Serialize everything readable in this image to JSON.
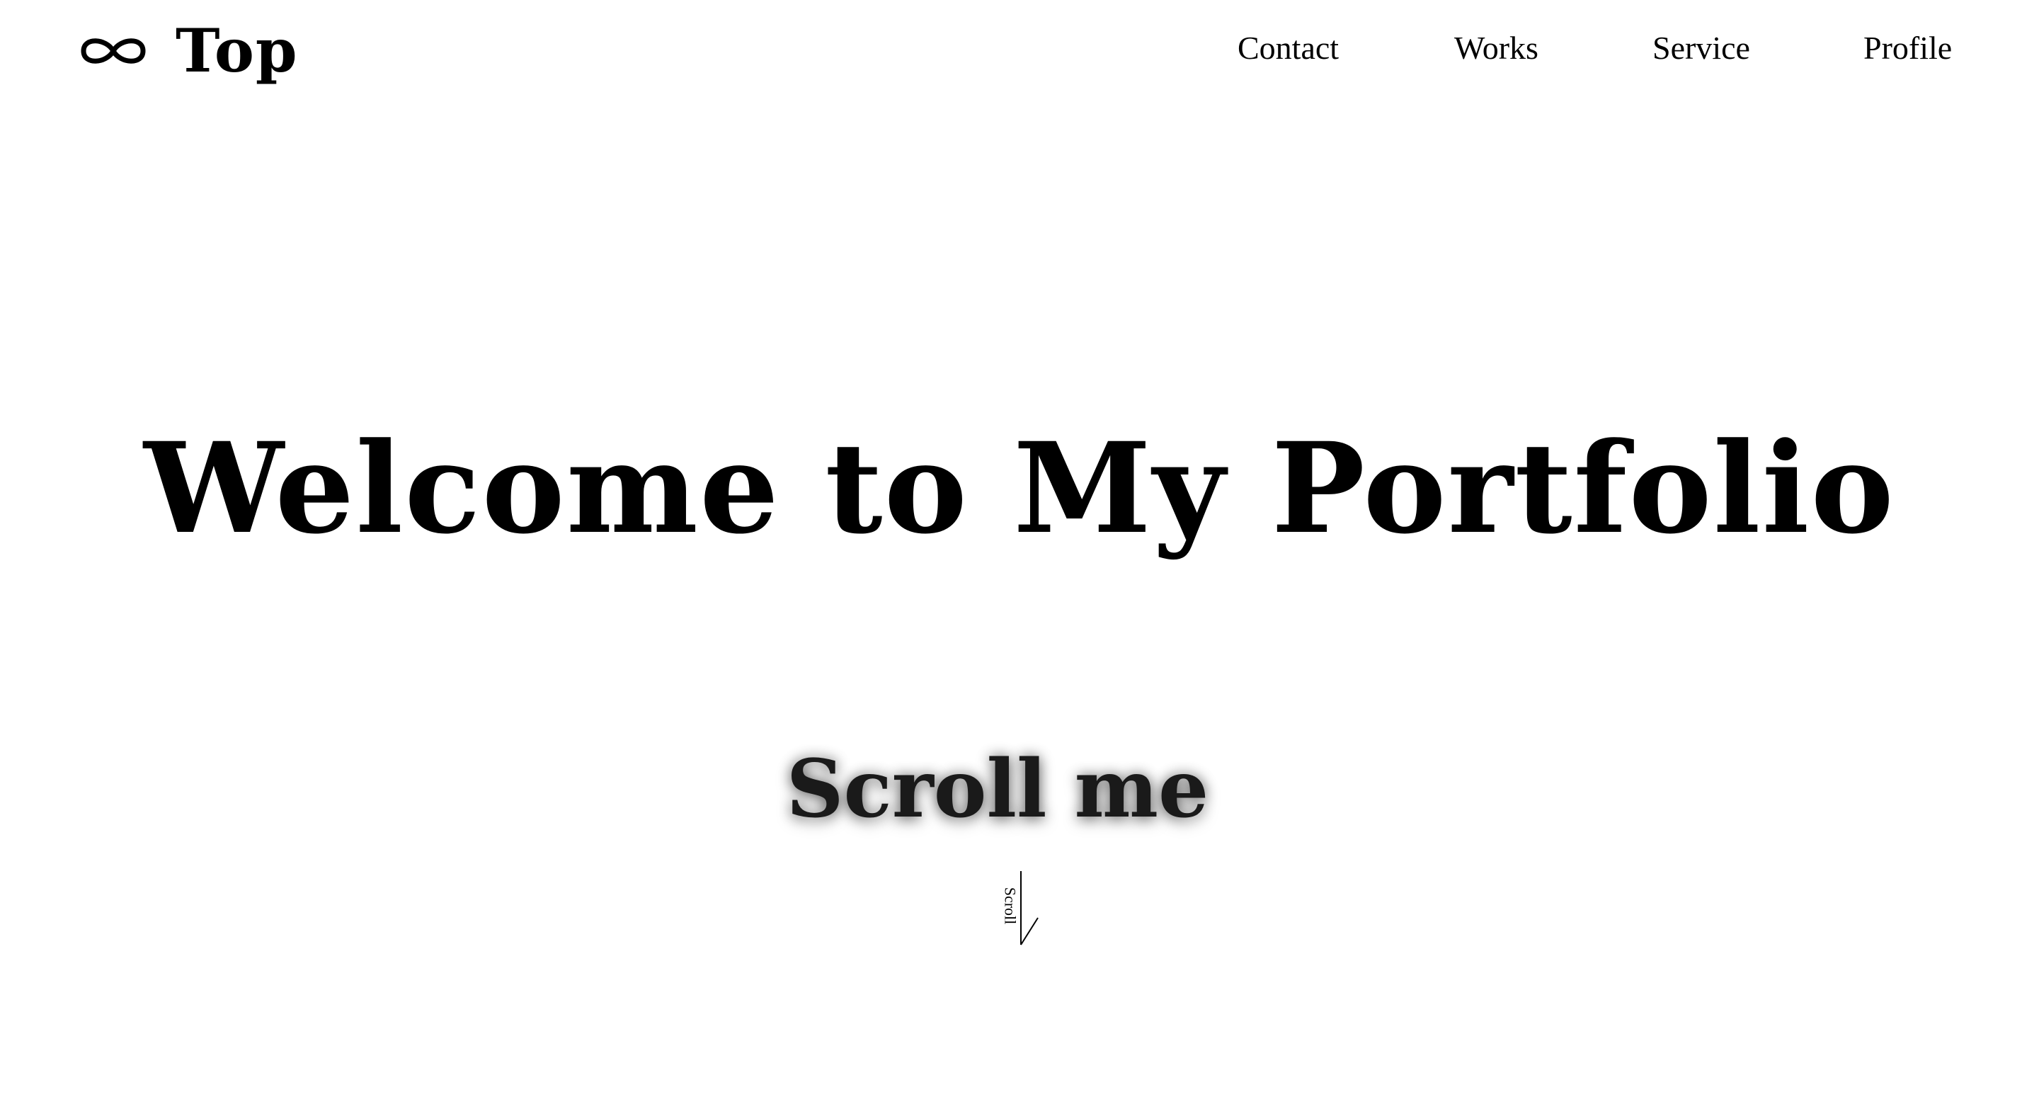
{
  "header": {
    "logo_icon": "infinity-icon",
    "logo_text": "Top"
  },
  "nav": {
    "items": [
      {
        "label": "Contact"
      },
      {
        "label": "Works"
      },
      {
        "label": "Service"
      },
      {
        "label": "Profile"
      }
    ]
  },
  "hero": {
    "title": "Welcome to My Portfolio",
    "subtitle": "Scroll me"
  },
  "scroll_indicator": {
    "label": "Scroll",
    "icon": "scroll-down-arrow-icon"
  },
  "colors": {
    "background": "#ffffff",
    "text": "#000000"
  }
}
